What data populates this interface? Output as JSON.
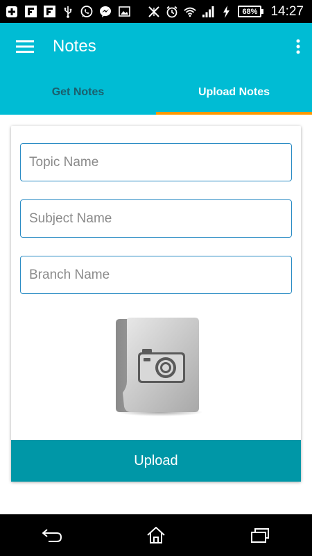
{
  "status_bar": {
    "time": "14:27",
    "battery_percent": "68%",
    "icons": [
      "plus-icon",
      "flipboard-icon",
      "flipboard-icon",
      "usb-icon",
      "whatsapp-icon",
      "messenger-icon",
      "image-icon",
      "mute-icon",
      "alarm-icon",
      "wifi-icon",
      "signal-icon",
      "charging-icon",
      "battery-icon"
    ]
  },
  "app_bar": {
    "title": "Notes",
    "color": "#00bcd4",
    "tabs": [
      {
        "label": "Get Notes",
        "selected": false
      },
      {
        "label": "Upload Notes",
        "selected": true
      }
    ],
    "indicator_color": "#ff9800"
  },
  "form": {
    "topic": {
      "placeholder": "Topic Name",
      "value": ""
    },
    "subject": {
      "placeholder": "Subject Name",
      "value": ""
    },
    "branch": {
      "placeholder": "Branch Name",
      "value": ""
    },
    "image_picker_icon": "camera-folder-icon",
    "upload_label": "Upload",
    "upload_color": "#0097a7"
  },
  "nav_bar": {
    "icons": [
      "back-icon",
      "home-icon",
      "recents-icon"
    ]
  }
}
